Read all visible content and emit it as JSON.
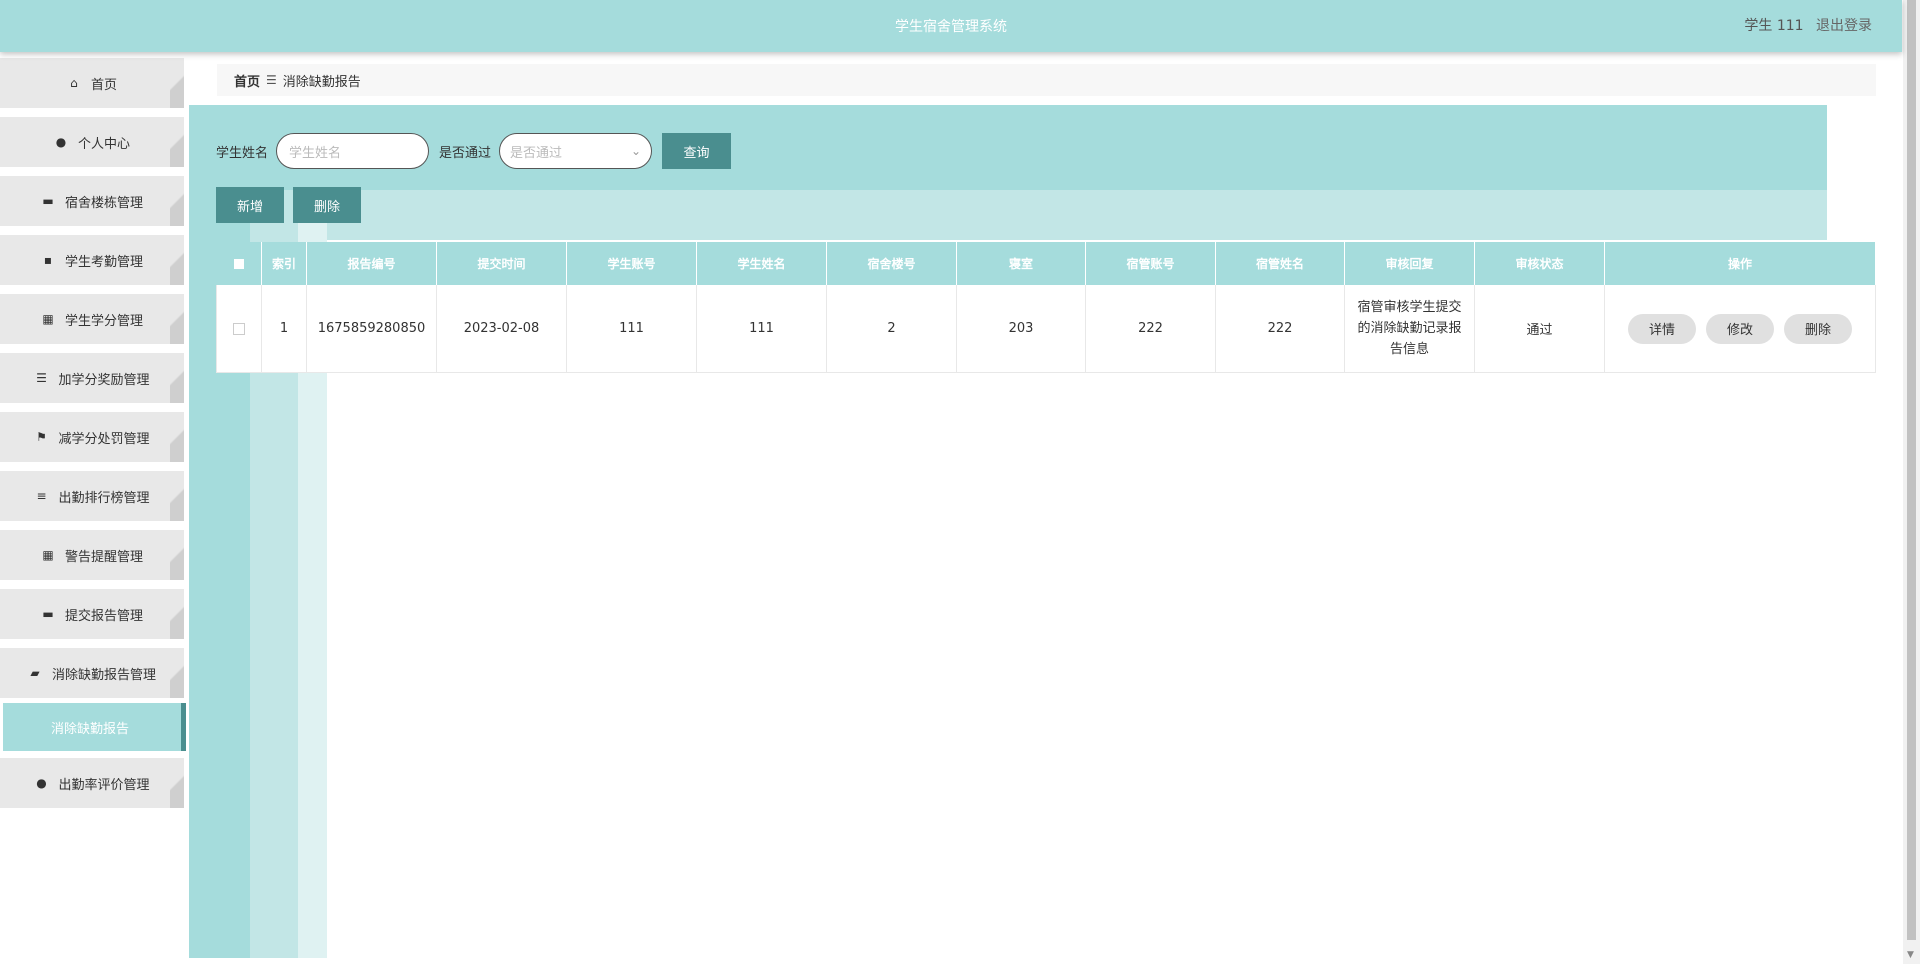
{
  "header": {
    "title": "学生宿舍管理系统",
    "user": "学生 111",
    "logout": "退出登录"
  },
  "sidebar": {
    "items": [
      {
        "label": "首页",
        "icon": "home-icon"
      },
      {
        "label": "个人中心",
        "icon": "user-icon"
      },
      {
        "label": "宿舍楼栋管理",
        "icon": "ticket-icon"
      },
      {
        "label": "学生考勤管理",
        "icon": "comment-icon"
      },
      {
        "label": "学生学分管理",
        "icon": "grid-icon"
      },
      {
        "label": "加学分奖励管理",
        "icon": "list-icon"
      },
      {
        "label": "减学分处罚管理",
        "icon": "flag-icon"
      },
      {
        "label": "出勤排行榜管理",
        "icon": "sliders-icon"
      },
      {
        "label": "警告提醒管理",
        "icon": "grid-icon"
      },
      {
        "label": "提交报告管理",
        "icon": "briefcase-icon"
      },
      {
        "label": "消除缺勤报告管理",
        "icon": "wallet-icon"
      },
      {
        "label": "出勤率评价管理",
        "icon": "bulb-icon"
      }
    ],
    "active_sub": "消除缺勤报告"
  },
  "breadcrumb": {
    "home": "首页",
    "sep": "☰",
    "current": "消除缺勤报告"
  },
  "search": {
    "name_label": "学生姓名",
    "name_placeholder": "学生姓名",
    "pass_label": "是否通过",
    "pass_placeholder": "是否通过",
    "query_btn": "查询"
  },
  "actions": {
    "add": "新增",
    "delete": "删除"
  },
  "table": {
    "headers": [
      "索引",
      "报告编号",
      "提交时间",
      "学生账号",
      "学生姓名",
      "宿舍楼号",
      "寝室",
      "宿管账号",
      "宿管姓名",
      "审核回复",
      "审核状态",
      "操作"
    ],
    "rows": [
      {
        "index": "1",
        "report_no": "1675859280850",
        "submit_time": "2023-02-08",
        "student_account": "111",
        "student_name": "111",
        "building": "2",
        "room": "203",
        "manager_account": "222",
        "manager_name": "222",
        "reply": "宿管审核学生提交的消除缺勤记录报告信息",
        "status": "通过",
        "ops": [
          "详情",
          "修改",
          "删除"
        ]
      }
    ]
  },
  "colors": {
    "primary": "#a5dcdc",
    "accent": "#4a8e8f"
  }
}
